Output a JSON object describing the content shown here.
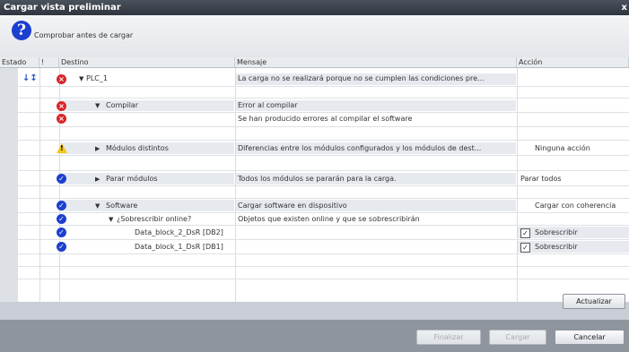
{
  "window": {
    "title": "Cargar vista preliminar",
    "close_symbol": "x"
  },
  "header": {
    "icon": "question-icon",
    "text": "Comprobar antes de cargar"
  },
  "columns": {
    "estado": "Estado",
    "bang": "!",
    "destino": "Destino",
    "mensaje": "Mensaje",
    "accion": "Acción"
  },
  "rows": [
    {
      "estado_icon": "download-icon",
      "bang_icon": "error-icon",
      "expand": "▼",
      "destino": "PLC_1",
      "mensaje": "La carga no se realizará porque no se cumplen las condiciones pre...",
      "accion": ""
    },
    {
      "bang_icon": "error-icon",
      "expand": "▼",
      "destino": "Compilar",
      "mensaje": "Error al compilar",
      "accion": ""
    },
    {
      "bang_icon": "error-icon",
      "destino": "",
      "mensaje": "Se han producido errores al compilar el software",
      "accion": ""
    },
    {
      "bang_icon": "warning-icon",
      "expand": "▶",
      "destino": "Módulos distintos",
      "mensaje": "Diferencias entre los módulos configurados y los módulos de dest...",
      "accion": "Ninguna acción"
    },
    {
      "bang_icon": "ok-icon",
      "expand": "▶",
      "destino": "Parar módulos",
      "mensaje": "Todos los módulos se pararán para la carga.",
      "accion": "Parar todos"
    },
    {
      "bang_icon": "ok-icon",
      "expand": "▼",
      "destino": "Software",
      "mensaje": "Cargar software en dispositivo",
      "accion": "Cargar con coherencia"
    },
    {
      "bang_icon": "ok-icon",
      "expand": "▼",
      "destino": "¿Sobrescribir online?",
      "mensaje": "Objetos que existen online y que se sobrescribirán",
      "accion": ""
    },
    {
      "bang_icon": "ok-icon",
      "destino": "Data_block_2_DsR [DB2]",
      "mensaje": "",
      "accion": "Sobrescribir",
      "checked": true
    },
    {
      "bang_icon": "ok-icon",
      "destino": "Data_block_1_DsR [DB1]",
      "mensaje": "",
      "accion": "Sobrescribir",
      "checked": true
    }
  ],
  "buttons": {
    "actualizar": "Actualizar",
    "finalizar": "Finalizar",
    "cargar": "Cargar",
    "cancelar": "Cancelar"
  }
}
